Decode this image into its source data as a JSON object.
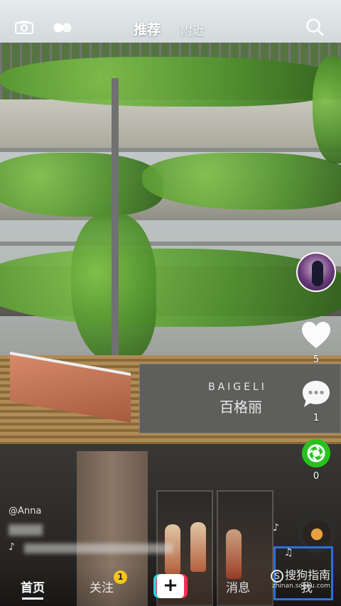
{
  "top_bar": {
    "tab_recommend": "推荐",
    "tab_nearby": "附近",
    "icons": [
      "camera-icon",
      "dual-camera-icon",
      "search-icon"
    ]
  },
  "video": {
    "sign_english": "BAIGELI",
    "sign_chinese": "百格丽",
    "author_handle": "@Anna"
  },
  "actions": {
    "like_count": "5",
    "comment_count": "1",
    "share_count": "0",
    "icons": [
      "heart-icon",
      "comment-icon",
      "share-icon",
      "music-note-icon"
    ]
  },
  "bottom_nav": {
    "home": "首页",
    "follow": "关注",
    "follow_badge": "1",
    "add": "+",
    "messages": "消息",
    "me": "我"
  },
  "watermark": {
    "brand": "搜狗指南",
    "brand_letter": "S",
    "url": "zhinan.sogou.com"
  },
  "colors": {
    "badge": "#f5c518",
    "share_green": "#27c21d",
    "add_cyan": "#28d3e0",
    "add_red": "#ff2d55",
    "highlight": "#2f6fe0"
  }
}
